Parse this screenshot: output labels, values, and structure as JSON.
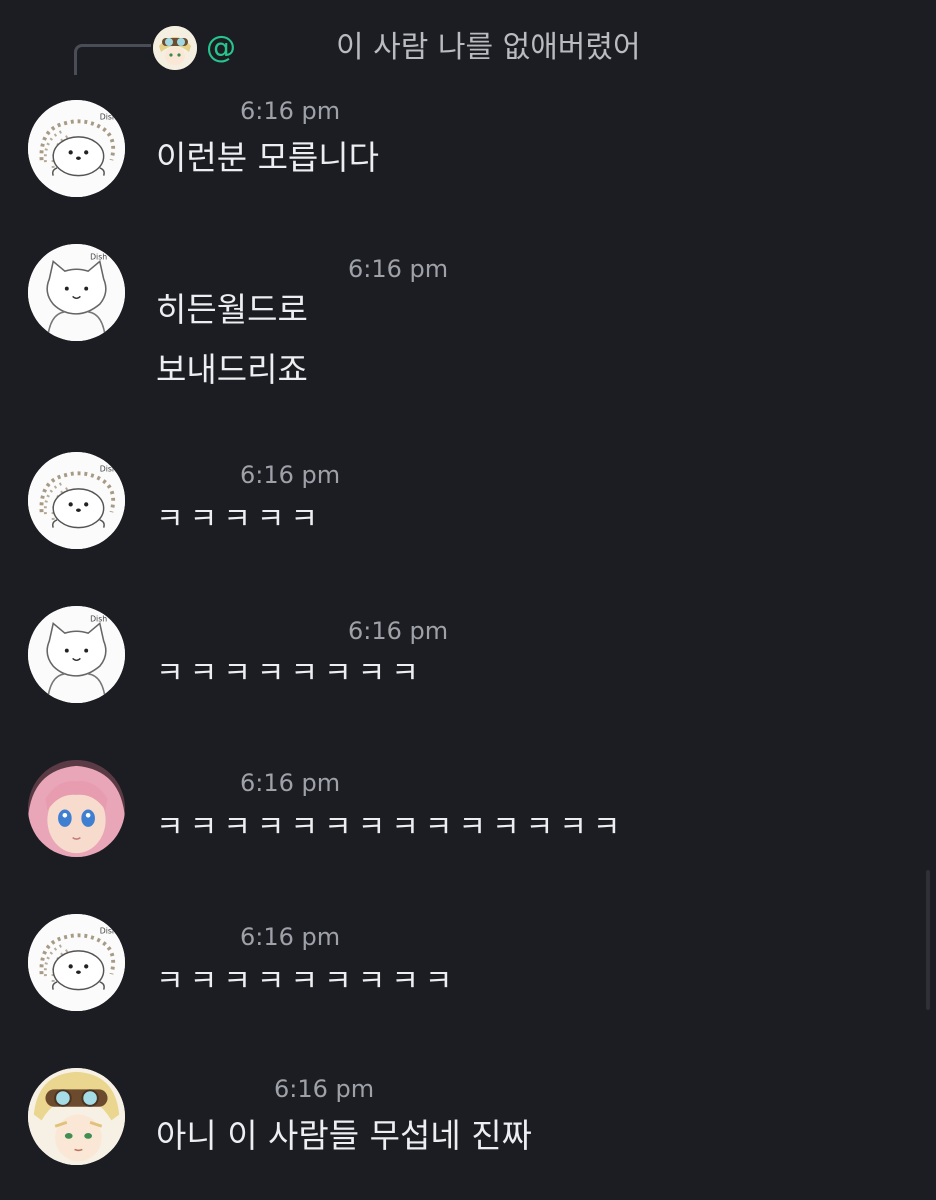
{
  "reply": {
    "mention": "@",
    "preview_text": "이 사람 나를 없애버렸어"
  },
  "messages": [
    {
      "avatar": "hedgehog-avatar",
      "time": "6:16 pm",
      "lines": [
        "이런분 모릅니다"
      ]
    },
    {
      "avatar": "cat-avatar",
      "time": "6:16 pm",
      "lines": [
        "히든월드로",
        "보내드리죠"
      ]
    },
    {
      "avatar": "hedgehog-avatar",
      "time": "6:16 pm",
      "lines": [
        "ㅋㅋㅋㅋㅋ"
      ]
    },
    {
      "avatar": "cat-avatar",
      "time": "6:16 pm",
      "lines": [
        "ㅋㅋㅋㅋㅋㅋㅋㅋ"
      ]
    },
    {
      "avatar": "pink-hair-anime-avatar",
      "time": "6:16 pm",
      "lines": [
        "ㅋㅋㅋㅋㅋㅋㅋㅋㅋㅋㅋㅋㅋㅋ"
      ]
    },
    {
      "avatar": "hedgehog-avatar",
      "time": "6:16 pm",
      "lines": [
        "ㅋㅋㅋㅋㅋㅋㅋㅋㅋ"
      ]
    },
    {
      "avatar": "goggles-anime-avatar",
      "time": "6:16 pm",
      "lines": [
        "아니 이 사람들 무섭네 진짜"
      ]
    }
  ]
}
